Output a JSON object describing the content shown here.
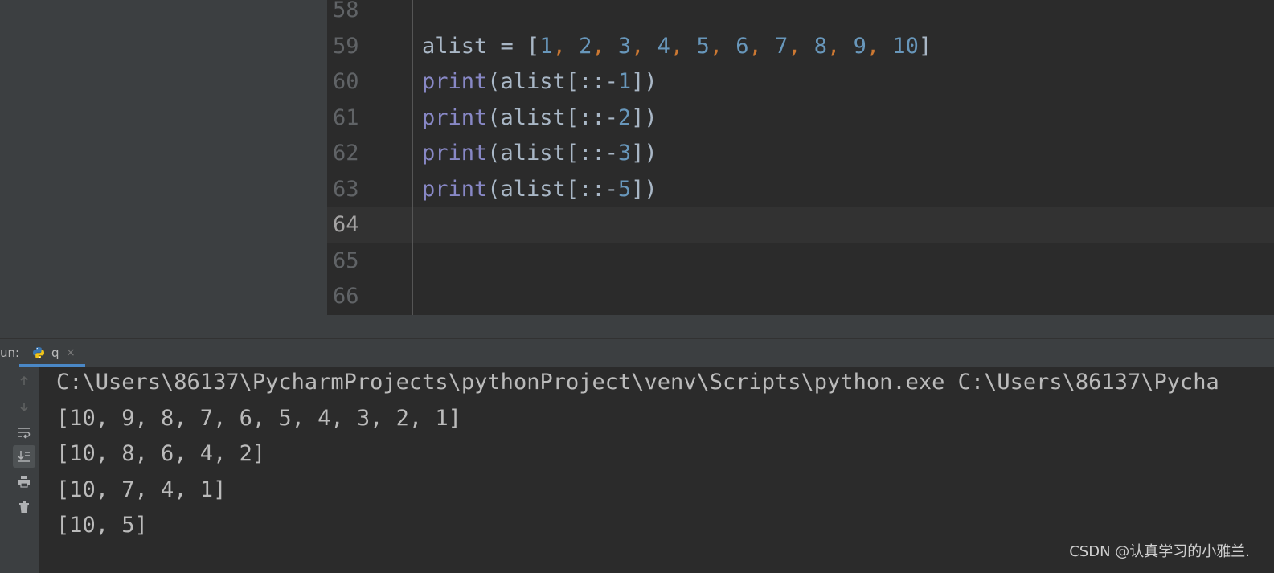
{
  "editor": {
    "lines": [
      {
        "num": "58",
        "tokens": []
      },
      {
        "num": "59",
        "tokens": [
          {
            "t": "alist = [",
            "c": ""
          },
          {
            "t": "1",
            "c": "num"
          },
          {
            "t": ", ",
            "c": "comma"
          },
          {
            "t": "2",
            "c": "num"
          },
          {
            "t": ", ",
            "c": "comma"
          },
          {
            "t": "3",
            "c": "num"
          },
          {
            "t": ", ",
            "c": "comma"
          },
          {
            "t": "4",
            "c": "num"
          },
          {
            "t": ", ",
            "c": "comma"
          },
          {
            "t": "5",
            "c": "num"
          },
          {
            "t": ", ",
            "c": "comma"
          },
          {
            "t": "6",
            "c": "num"
          },
          {
            "t": ", ",
            "c": "comma"
          },
          {
            "t": "7",
            "c": "num"
          },
          {
            "t": ", ",
            "c": "comma"
          },
          {
            "t": "8",
            "c": "num"
          },
          {
            "t": ", ",
            "c": "comma"
          },
          {
            "t": "9",
            "c": "num"
          },
          {
            "t": ", ",
            "c": "comma"
          },
          {
            "t": "10",
            "c": "num"
          },
          {
            "t": "]",
            "c": ""
          }
        ]
      },
      {
        "num": "60",
        "tokens": [
          {
            "t": "print",
            "c": "fn"
          },
          {
            "t": "(alist[::-",
            "c": ""
          },
          {
            "t": "1",
            "c": "num"
          },
          {
            "t": "])",
            "c": ""
          }
        ]
      },
      {
        "num": "61",
        "tokens": [
          {
            "t": "print",
            "c": "fn"
          },
          {
            "t": "(alist[::-",
            "c": ""
          },
          {
            "t": "2",
            "c": "num"
          },
          {
            "t": "])",
            "c": ""
          }
        ]
      },
      {
        "num": "62",
        "tokens": [
          {
            "t": "print",
            "c": "fn"
          },
          {
            "t": "(alist[::-",
            "c": ""
          },
          {
            "t": "3",
            "c": "num"
          },
          {
            "t": "])",
            "c": ""
          }
        ]
      },
      {
        "num": "63",
        "tokens": [
          {
            "t": "print",
            "c": "fn"
          },
          {
            "t": "(alist[::-",
            "c": ""
          },
          {
            "t": "5",
            "c": "num"
          },
          {
            "t": "])",
            "c": ""
          }
        ]
      },
      {
        "num": "64",
        "tokens": [],
        "current": true
      },
      {
        "num": "65",
        "tokens": []
      },
      {
        "num": "66",
        "tokens": []
      }
    ]
  },
  "run": {
    "label": "un:",
    "tab_label": "q",
    "tab_close": "×",
    "output": [
      "C:\\Users\\86137\\PycharmProjects\\pythonProject\\venv\\Scripts\\python.exe C:\\Users\\86137\\Pycha",
      "[10, 9, 8, 7, 6, 5, 4, 3, 2, 1]",
      "[10, 8, 6, 4, 2]",
      "[10, 7, 4, 1]",
      "[10, 5]"
    ],
    "toolbar": [
      "up-arrow-icon",
      "down-arrow-icon",
      "soft-wrap-icon",
      "scroll-to-end-icon",
      "print-icon",
      "trash-icon"
    ]
  },
  "watermark": "CSDN @认真学习的小雅兰.",
  "colors": {
    "background": "#2b2b2b",
    "panel": "#3c3f41",
    "code_text": "#a9b7c6",
    "builtin": "#8888c6",
    "number": "#6897bb",
    "comma": "#cc7832",
    "line_number": "#606366",
    "console_text": "#bbbbbb"
  }
}
